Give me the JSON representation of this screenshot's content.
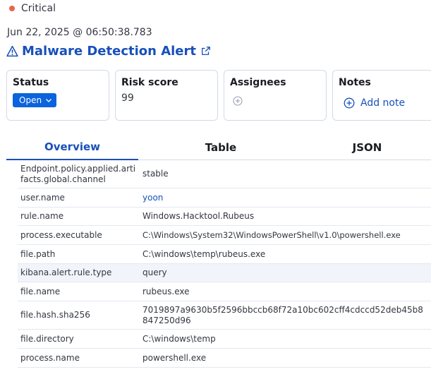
{
  "severity": {
    "label": "Critical",
    "color": "#e7664c"
  },
  "timestamp": "Jun 22, 2025 @ 06:50:38.783",
  "title": {
    "text": "Malware Detection Alert",
    "icon": "warning-icon",
    "link_icon": "external-link-icon"
  },
  "cards": {
    "status": {
      "label": "Status",
      "value": "Open"
    },
    "risk": {
      "label": "Risk score",
      "value": "99"
    },
    "assignees": {
      "label": "Assignees"
    },
    "notes": {
      "label": "Notes",
      "action": "Add note"
    }
  },
  "tabs": [
    {
      "label": "Overview",
      "active": true
    },
    {
      "label": "Table",
      "active": false
    },
    {
      "label": "JSON",
      "active": false
    }
  ],
  "rows": [
    {
      "field": "Endpoint.policy.applied.artifacts.global.channel",
      "value": "stable"
    },
    {
      "field": "user.name",
      "value": "yoon"
    },
    {
      "field": "rule.name",
      "value": "Windows.Hacktool.Rubeus"
    },
    {
      "field": "process.executable",
      "value": "C:\\Windows\\System32\\WindowsPowerShell\\v1.0\\powershell.exe"
    },
    {
      "field": "file.path",
      "value": "C:\\windows\\temp\\rubeus.exe"
    },
    {
      "field": "kibana.alert.rule.type",
      "value": "query"
    },
    {
      "field": "file.name",
      "value": "rubeus.exe"
    },
    {
      "field": "file.hash.sha256",
      "value": "7019897a9630b5f2596bbccb68f72a10bc602cff4cdccd52deb45b8847250d96"
    },
    {
      "field": "file.directory",
      "value": "C:\\windows\\temp"
    },
    {
      "field": "process.name",
      "value": "powershell.exe"
    }
  ],
  "colors": {
    "link": "#1750ba",
    "badge": "#0b64dd",
    "border": "#d3dae6"
  }
}
